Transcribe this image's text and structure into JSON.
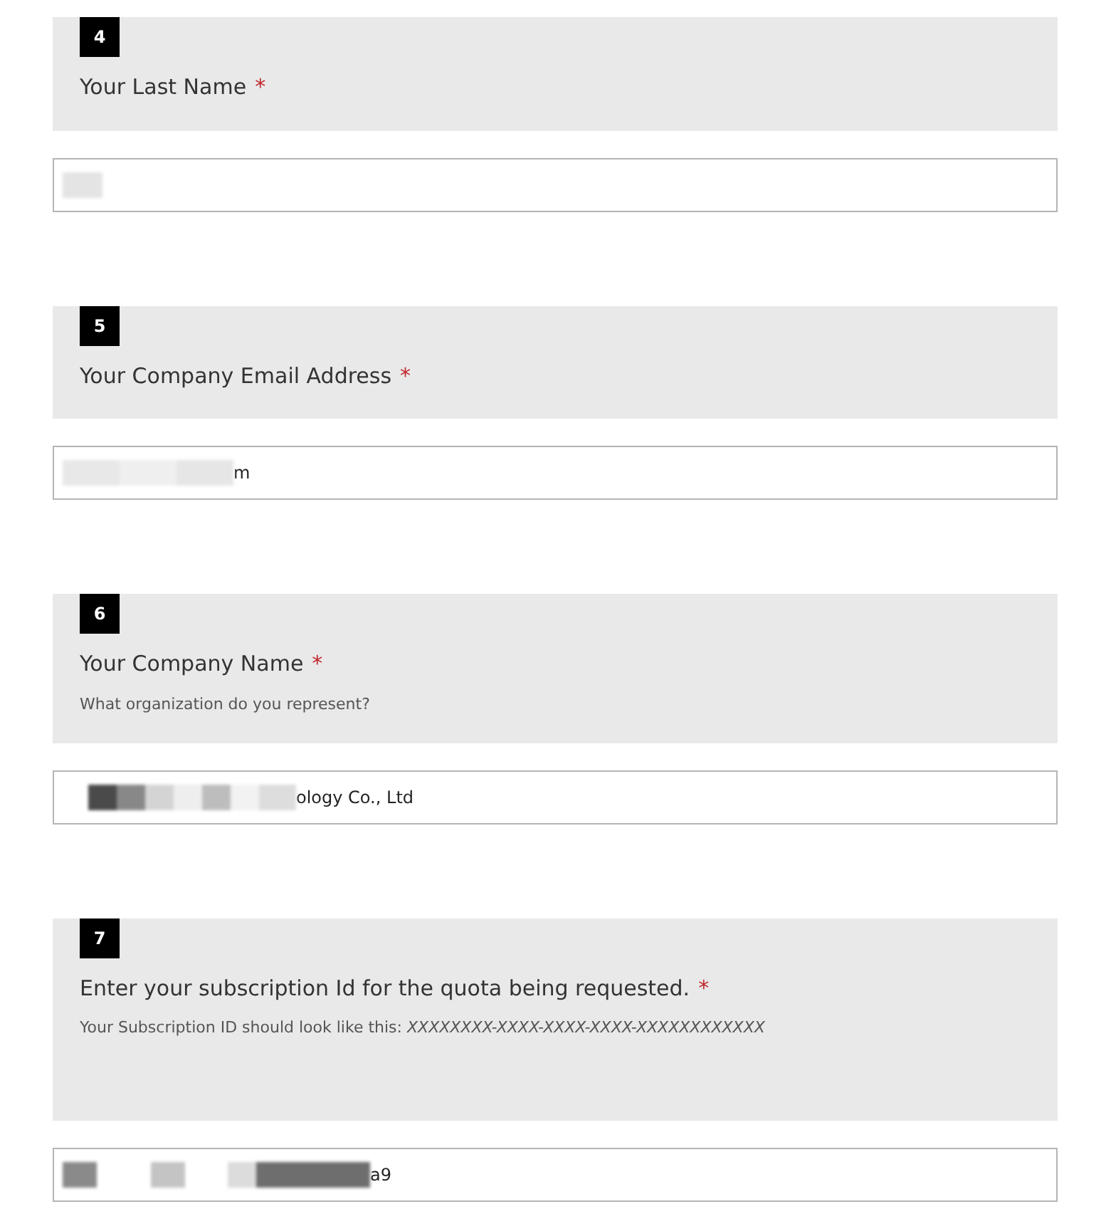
{
  "questions": [
    {
      "number": "4",
      "title": "Your Last Name",
      "required_mark": "*"
    },
    {
      "number": "5",
      "title": "Your Company Email Address",
      "required_mark": "*",
      "value": "m"
    },
    {
      "number": "6",
      "title": "Your Company Name",
      "required_mark": "*",
      "hint": "What organization do you represent?",
      "value": "ology Co., Ltd"
    },
    {
      "number": "7",
      "title": "Enter your subscription Id for the quota being requested.",
      "required_mark": "*",
      "hint": "Your Subscription ID should look like this: *XXXXXXXX-XXXX-XXXX-XXXX-XXXXXXXXXXXX*",
      "value": "a9"
    }
  ]
}
